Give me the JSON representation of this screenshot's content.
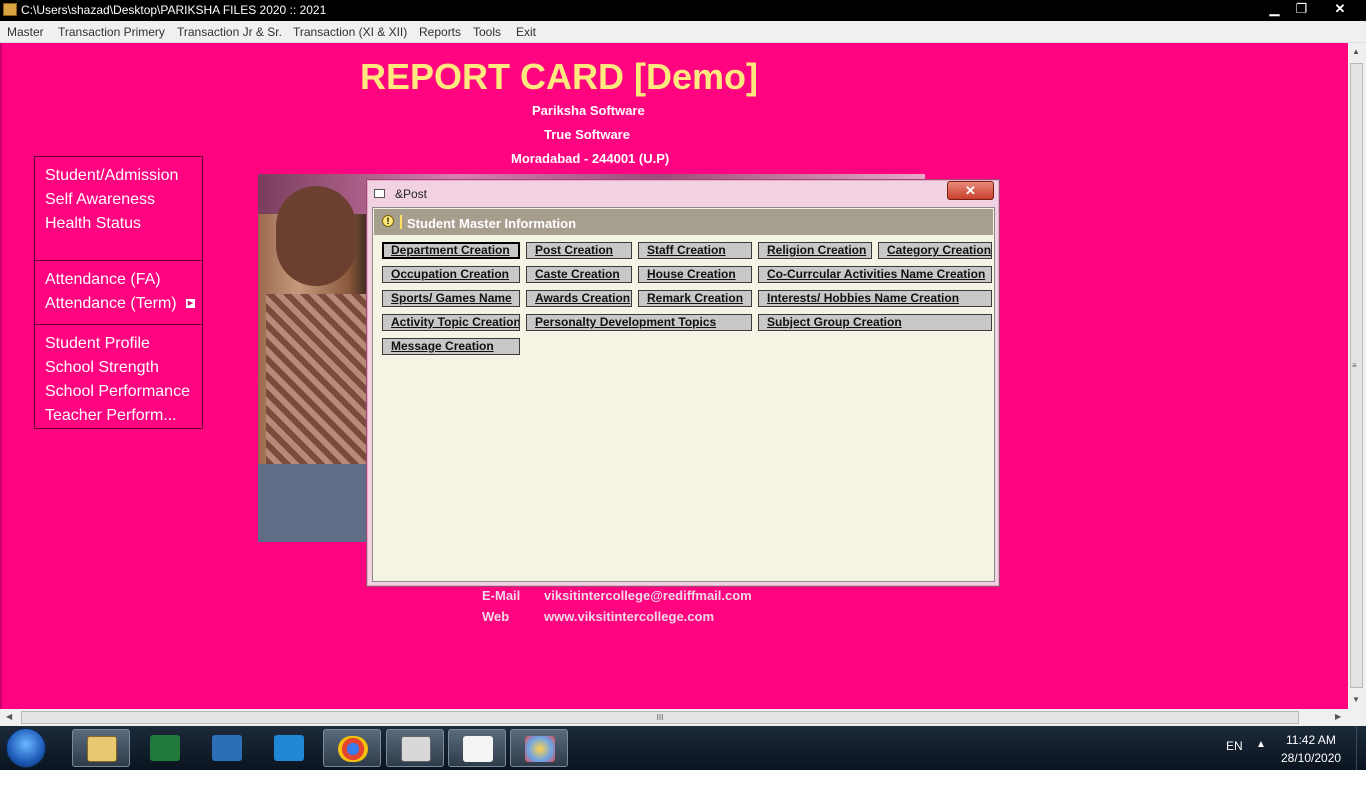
{
  "window": {
    "title": "C:\\Users\\shazad\\Desktop\\PARIKSHA FILES 2020 :: 2021",
    "controls": {
      "minimize": "▁",
      "maximize": "❐",
      "close": "✕"
    }
  },
  "menubar": [
    "Master",
    "Transaction Primery",
    "Transaction Jr & Sr.",
    "Transaction (XI & XII)",
    "Reports",
    "Tools",
    "Exit"
  ],
  "main": {
    "title": "REPORT CARD [Demo]",
    "lines": [
      "Pariksha Software",
      "True Software",
      "Moradabad - 244001 (U.P)"
    ]
  },
  "left_menu": {
    "group1": [
      "Student/Admission",
      "Self Awareness",
      "Health Status"
    ],
    "group2": [
      "Attendance (FA)",
      "Attendance (Term)"
    ],
    "group3": [
      "Student Profile",
      "School Strength",
      "School Performance",
      "Teacher Perform..."
    ]
  },
  "contact": {
    "email_label": "E-Mail",
    "email": "viksitintercollege@rediffmail.com",
    "web_label": "Web",
    "web": "www.viksitintercollege.com"
  },
  "dialog": {
    "title": "&Post",
    "close": "✕",
    "header": "Student Master Information",
    "header_icon": "!",
    "buttons": [
      "Department Creation",
      "Post Creation",
      "Staff Creation",
      "Religion Creation",
      "Category Creation",
      "Occupation Creation",
      "Caste Creation",
      "House Creation",
      "Co-Currcular Activities Name Creation",
      "Sports/ Games Name",
      "Awards Creation",
      "Remark Creation",
      "Interests/ Hobbies Name Creation",
      "Activity Topic Creation",
      "Personalty Development Topics",
      "Subject Group Creation",
      "Message Creation"
    ]
  },
  "scrollbar": {
    "grip": "III",
    "left": "◀",
    "right": "▶",
    "up": "▲",
    "down": "▼",
    "side_grip": "≡"
  },
  "taskbar": {
    "apps": [
      "file-explorer-icon",
      "excel-icon",
      "app-icon",
      "vscode-icon",
      "chrome-icon",
      "tool-icon",
      "folder-icon",
      "paint-icon"
    ],
    "lang": "EN",
    "tray_arrow": "▲",
    "time": "11:42 AM",
    "date": "28/10/2020"
  },
  "colors": {
    "background": "#ff0380",
    "title": "#ffe97e",
    "dialog_header": "#a79f8e",
    "dialog_body": "#f5f3e3"
  }
}
